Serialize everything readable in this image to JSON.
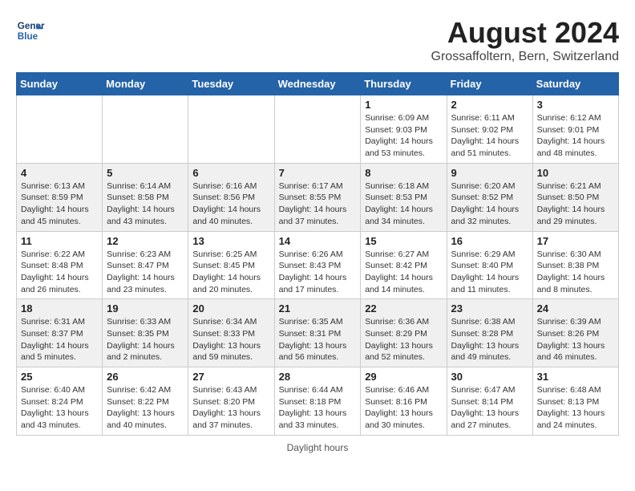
{
  "header": {
    "logo_line1": "General",
    "logo_line2": "Blue",
    "main_title": "August 2024",
    "subtitle": "Grossaffoltern, Bern, Switzerland"
  },
  "days_of_week": [
    "Sunday",
    "Monday",
    "Tuesday",
    "Wednesday",
    "Thursday",
    "Friday",
    "Saturday"
  ],
  "footer_text": "Daylight hours",
  "weeks": [
    [
      {
        "day": "",
        "info": ""
      },
      {
        "day": "",
        "info": ""
      },
      {
        "day": "",
        "info": ""
      },
      {
        "day": "",
        "info": ""
      },
      {
        "day": "1",
        "info": "Sunrise: 6:09 AM\nSunset: 9:03 PM\nDaylight: 14 hours and 53 minutes."
      },
      {
        "day": "2",
        "info": "Sunrise: 6:11 AM\nSunset: 9:02 PM\nDaylight: 14 hours and 51 minutes."
      },
      {
        "day": "3",
        "info": "Sunrise: 6:12 AM\nSunset: 9:01 PM\nDaylight: 14 hours and 48 minutes."
      }
    ],
    [
      {
        "day": "4",
        "info": "Sunrise: 6:13 AM\nSunset: 8:59 PM\nDaylight: 14 hours and 45 minutes."
      },
      {
        "day": "5",
        "info": "Sunrise: 6:14 AM\nSunset: 8:58 PM\nDaylight: 14 hours and 43 minutes."
      },
      {
        "day": "6",
        "info": "Sunrise: 6:16 AM\nSunset: 8:56 PM\nDaylight: 14 hours and 40 minutes."
      },
      {
        "day": "7",
        "info": "Sunrise: 6:17 AM\nSunset: 8:55 PM\nDaylight: 14 hours and 37 minutes."
      },
      {
        "day": "8",
        "info": "Sunrise: 6:18 AM\nSunset: 8:53 PM\nDaylight: 14 hours and 34 minutes."
      },
      {
        "day": "9",
        "info": "Sunrise: 6:20 AM\nSunset: 8:52 PM\nDaylight: 14 hours and 32 minutes."
      },
      {
        "day": "10",
        "info": "Sunrise: 6:21 AM\nSunset: 8:50 PM\nDaylight: 14 hours and 29 minutes."
      }
    ],
    [
      {
        "day": "11",
        "info": "Sunrise: 6:22 AM\nSunset: 8:48 PM\nDaylight: 14 hours and 26 minutes."
      },
      {
        "day": "12",
        "info": "Sunrise: 6:23 AM\nSunset: 8:47 PM\nDaylight: 14 hours and 23 minutes."
      },
      {
        "day": "13",
        "info": "Sunrise: 6:25 AM\nSunset: 8:45 PM\nDaylight: 14 hours and 20 minutes."
      },
      {
        "day": "14",
        "info": "Sunrise: 6:26 AM\nSunset: 8:43 PM\nDaylight: 14 hours and 17 minutes."
      },
      {
        "day": "15",
        "info": "Sunrise: 6:27 AM\nSunset: 8:42 PM\nDaylight: 14 hours and 14 minutes."
      },
      {
        "day": "16",
        "info": "Sunrise: 6:29 AM\nSunset: 8:40 PM\nDaylight: 14 hours and 11 minutes."
      },
      {
        "day": "17",
        "info": "Sunrise: 6:30 AM\nSunset: 8:38 PM\nDaylight: 14 hours and 8 minutes."
      }
    ],
    [
      {
        "day": "18",
        "info": "Sunrise: 6:31 AM\nSunset: 8:37 PM\nDaylight: 14 hours and 5 minutes."
      },
      {
        "day": "19",
        "info": "Sunrise: 6:33 AM\nSunset: 8:35 PM\nDaylight: 14 hours and 2 minutes."
      },
      {
        "day": "20",
        "info": "Sunrise: 6:34 AM\nSunset: 8:33 PM\nDaylight: 13 hours and 59 minutes."
      },
      {
        "day": "21",
        "info": "Sunrise: 6:35 AM\nSunset: 8:31 PM\nDaylight: 13 hours and 56 minutes."
      },
      {
        "day": "22",
        "info": "Sunrise: 6:36 AM\nSunset: 8:29 PM\nDaylight: 13 hours and 52 minutes."
      },
      {
        "day": "23",
        "info": "Sunrise: 6:38 AM\nSunset: 8:28 PM\nDaylight: 13 hours and 49 minutes."
      },
      {
        "day": "24",
        "info": "Sunrise: 6:39 AM\nSunset: 8:26 PM\nDaylight: 13 hours and 46 minutes."
      }
    ],
    [
      {
        "day": "25",
        "info": "Sunrise: 6:40 AM\nSunset: 8:24 PM\nDaylight: 13 hours and 43 minutes."
      },
      {
        "day": "26",
        "info": "Sunrise: 6:42 AM\nSunset: 8:22 PM\nDaylight: 13 hours and 40 minutes."
      },
      {
        "day": "27",
        "info": "Sunrise: 6:43 AM\nSunset: 8:20 PM\nDaylight: 13 hours and 37 minutes."
      },
      {
        "day": "28",
        "info": "Sunrise: 6:44 AM\nSunset: 8:18 PM\nDaylight: 13 hours and 33 minutes."
      },
      {
        "day": "29",
        "info": "Sunrise: 6:46 AM\nSunset: 8:16 PM\nDaylight: 13 hours and 30 minutes."
      },
      {
        "day": "30",
        "info": "Sunrise: 6:47 AM\nSunset: 8:14 PM\nDaylight: 13 hours and 27 minutes."
      },
      {
        "day": "31",
        "info": "Sunrise: 6:48 AM\nSunset: 8:13 PM\nDaylight: 13 hours and 24 minutes."
      }
    ]
  ]
}
